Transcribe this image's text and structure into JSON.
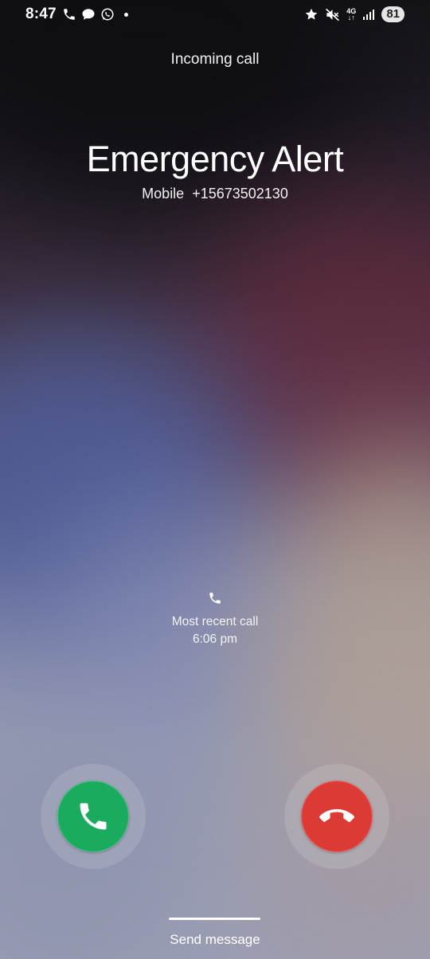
{
  "status_bar": {
    "time": "8:47",
    "left_icons": [
      "phone-icon",
      "chat-bubble-icon",
      "whatsapp-icon",
      "notification-dot"
    ],
    "right_icons": [
      "star-icon",
      "mute-icon",
      "network-4g-icon",
      "signal-icon"
    ],
    "network": "4G",
    "battery": "81"
  },
  "call": {
    "state": "Incoming call",
    "caller_name": "Emergency Alert",
    "number_line": "Mobile  +15673502130"
  },
  "recent": {
    "label": "Most recent call",
    "time": "6:06 pm"
  },
  "actions": {
    "accept_icon": "phone-icon",
    "decline_icon": "phone-hangup-icon",
    "send_message": "Send message"
  },
  "colors": {
    "accept": "#1bab5f",
    "decline": "#dc3a35"
  }
}
